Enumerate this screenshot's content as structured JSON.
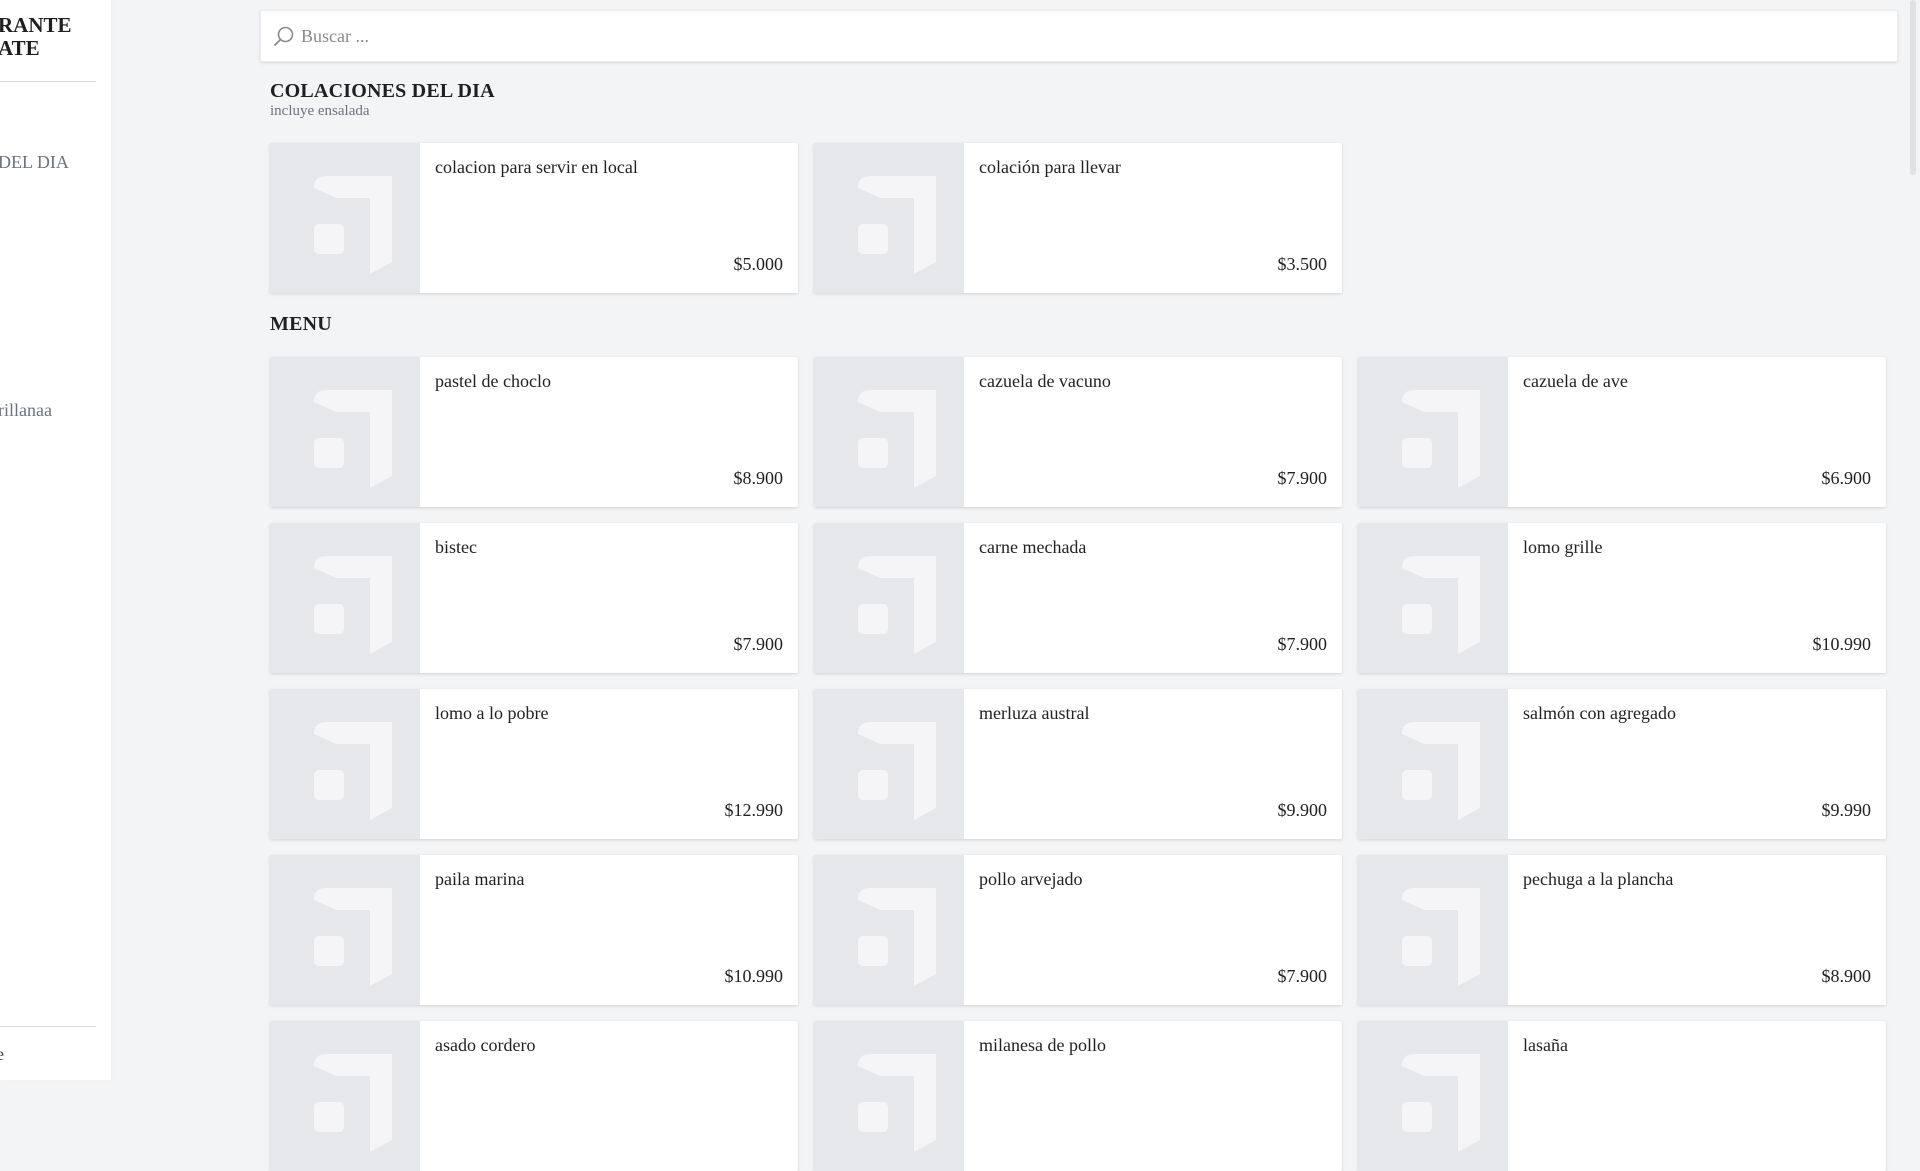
{
  "sidebar": {
    "title_line1": "RANTE",
    "title_line2": "ATE",
    "items": [
      {
        "label": "DEL DIA"
      },
      {
        "label": "rillanaa"
      }
    ],
    "footer_label": "e"
  },
  "search": {
    "placeholder": "Buscar ..."
  },
  "sections": [
    {
      "title": "COLACIONES DEL DIA",
      "subtitle": "incluye ensalada",
      "items": [
        {
          "name": "colacion para servir en local",
          "price": "$5.000"
        },
        {
          "name": "colación para llevar",
          "price": "$3.500"
        }
      ]
    },
    {
      "title": "MENU",
      "items": [
        {
          "name": "pastel de choclo",
          "price": "$8.900"
        },
        {
          "name": "cazuela de vacuno",
          "price": "$7.900"
        },
        {
          "name": "cazuela de ave",
          "price": "$6.900"
        },
        {
          "name": "bistec",
          "price": "$7.900"
        },
        {
          "name": "carne mechada",
          "price": "$7.900"
        },
        {
          "name": "lomo grille",
          "price": "$10.990"
        },
        {
          "name": "lomo a lo pobre",
          "price": "$12.990"
        },
        {
          "name": "merluza austral",
          "price": "$9.900"
        },
        {
          "name": "salmón con agregado",
          "price": "$9.990"
        },
        {
          "name": "paila marina",
          "price": "$10.990"
        },
        {
          "name": "pollo arvejado",
          "price": "$7.900"
        },
        {
          "name": "pechuga a la plancha",
          "price": "$8.900"
        },
        {
          "name": "asado cordero",
          "price": ""
        },
        {
          "name": "milanesa de pollo",
          "price": ""
        },
        {
          "name": "lasaña",
          "price": ""
        }
      ]
    }
  ],
  "colors": {
    "background": "#f3f4f6",
    "card": "#ffffff",
    "thumb_placeholder": "#e6e7eb",
    "muted_text": "#6b7280"
  },
  "icons": {
    "search": "search-icon",
    "product_placeholder": "image-placeholder-icon"
  }
}
